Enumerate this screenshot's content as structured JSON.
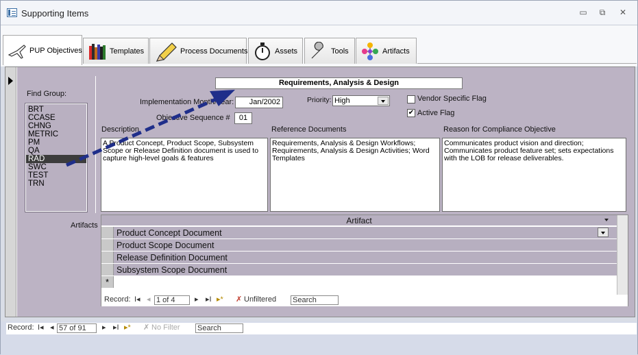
{
  "window": {
    "title": "Supporting Items",
    "minimize": "▭",
    "restore": "⧉",
    "close": "✕"
  },
  "tabs": [
    {
      "label": "PUP Objectives",
      "icon": "airplane-icon"
    },
    {
      "label": "Templates",
      "icon": "books-icon"
    },
    {
      "label": "Process Documents",
      "icon": "pencil-icon"
    },
    {
      "label": "Assets",
      "icon": "stopwatch-icon"
    },
    {
      "label": "Tools",
      "icon": "wrench-icon"
    },
    {
      "label": "Artifacts",
      "icon": "molecule-icon"
    }
  ],
  "form": {
    "find_group_label": "Find Group:",
    "groups": [
      "BRT",
      "CCASE",
      "CHNG",
      "METRIC",
      "PM",
      "QA",
      "RAD",
      "SWC",
      "TEST",
      "TRN"
    ],
    "selected_group": "RAD",
    "header": "Requirements, Analysis & Design",
    "impl_label": "Implementation Month/Year:",
    "impl_value": "Jan/2002",
    "priority_label": "Priority:",
    "priority_value": "High",
    "seq_label": "Objective Sequence #",
    "seq_value": "01",
    "vendor_flag_label": "Vendor Specific Flag",
    "vendor_flag_checked": false,
    "active_flag_label": "Active Flag",
    "active_flag_checked": true,
    "desc_label": "Description",
    "desc_value": "A Product Concept, Product Scope, Subsystem Scope or Release Definition document is used to capture high-level goals & features",
    "ref_label": "Reference Documents",
    "ref_value": "Requirements, Analysis & Design Workflows; Requirements, Analysis & Design Activities; Word Templates",
    "reason_label": "Reason for Compliance Objective",
    "reason_value": "Communicates product vision and direction; Communicates product feature set; sets expectations with the LOB for release deliverables.",
    "artifacts_label": "Artifacts"
  },
  "subform": {
    "column_header": "Artifact",
    "rows": [
      "Product Concept Document",
      "Product Scope Document",
      "Release Definition Document",
      "Subsystem Scope Document"
    ],
    "new_row_marker": "*",
    "nav": {
      "record_label": "Record:",
      "first": "I◂",
      "prev": "◂",
      "position": "1 of 4",
      "next": "▸",
      "last": "▸I",
      "new": "▸*",
      "filter": "Unfiltered",
      "search": "Search"
    }
  },
  "mainnav": {
    "record_label": "Record:",
    "first": "I◂",
    "prev": "◂",
    "position": "57 of 91",
    "next": "▸",
    "last": "▸I",
    "new": "▸*",
    "filter": "No Filter",
    "search": "Search"
  },
  "colors": {
    "form_bg": "#bcb3c4",
    "arrow": "#1f2e8a",
    "selected": "#3c3c3c"
  }
}
